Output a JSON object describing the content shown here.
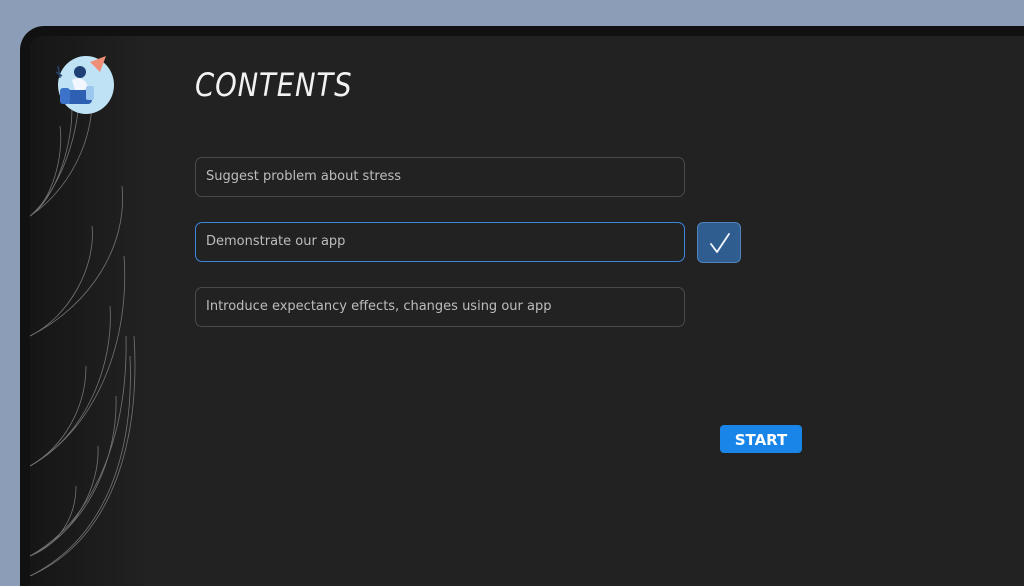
{
  "page": {
    "title": "CONTENTS"
  },
  "logo": {
    "name": "person-relaxing-illustration"
  },
  "items": [
    {
      "label": "Suggest problem about stress",
      "checked": false
    },
    {
      "label": "Demonstrate our app",
      "checked": true
    },
    {
      "label": "Introduce expectancy effects, changes using our app",
      "checked": false
    }
  ],
  "check_icon": "checkmark-icon",
  "actions": {
    "start_label": "START"
  },
  "colors": {
    "background": "#8c9db7",
    "screen": "#222222",
    "accent": "#1a85e8",
    "active_border": "#3d86dc",
    "check_fill": "#2f5d8f"
  }
}
